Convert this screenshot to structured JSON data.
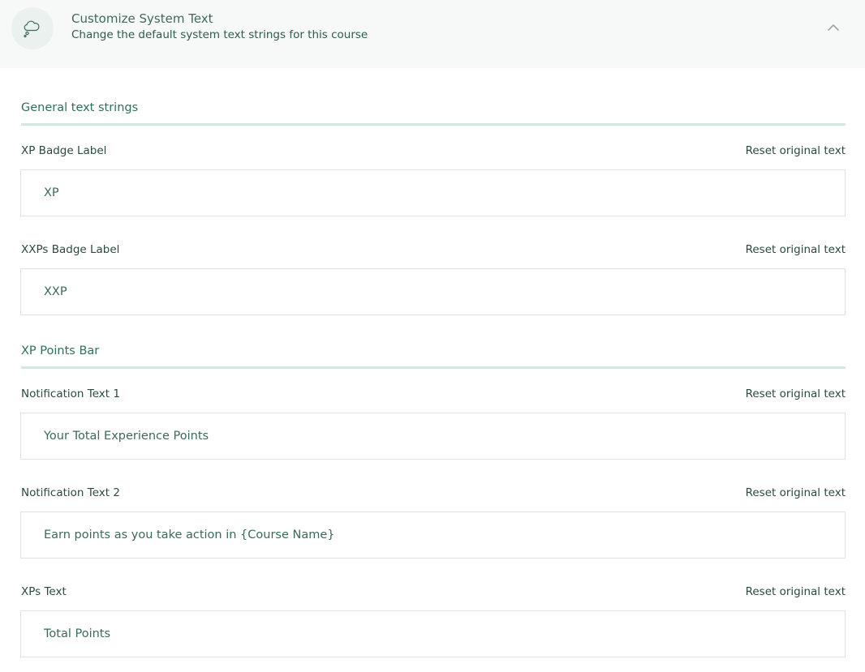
{
  "header": {
    "icon": "cloud-chat-icon",
    "title": "Customize System Text",
    "subtitle": "Change the default system text strings for this course",
    "collapse_icon": "chevron-up-icon"
  },
  "sections": [
    {
      "heading": "General text strings",
      "fields": [
        {
          "label": "XP Badge Label",
          "value": "XP",
          "reset_label": "Reset original text"
        },
        {
          "label": "XXPs Badge Label",
          "value": "XXP",
          "reset_label": "Reset original text"
        }
      ]
    },
    {
      "heading": "XP Points Bar",
      "fields": [
        {
          "label": "Notification Text 1",
          "value": "Your Total Experience Points",
          "reset_label": "Reset original text"
        },
        {
          "label": "Notification Text 2",
          "value": "Earn points as you take action in {Course Name}",
          "reset_label": "Reset original text"
        },
        {
          "label": "XPs Text",
          "value": "Total Points",
          "reset_label": "Reset original text"
        }
      ]
    }
  ],
  "colors": {
    "accent": "#2f6f5a",
    "header_bg": "#f7f8f8",
    "divider": "#d6e6e2"
  }
}
